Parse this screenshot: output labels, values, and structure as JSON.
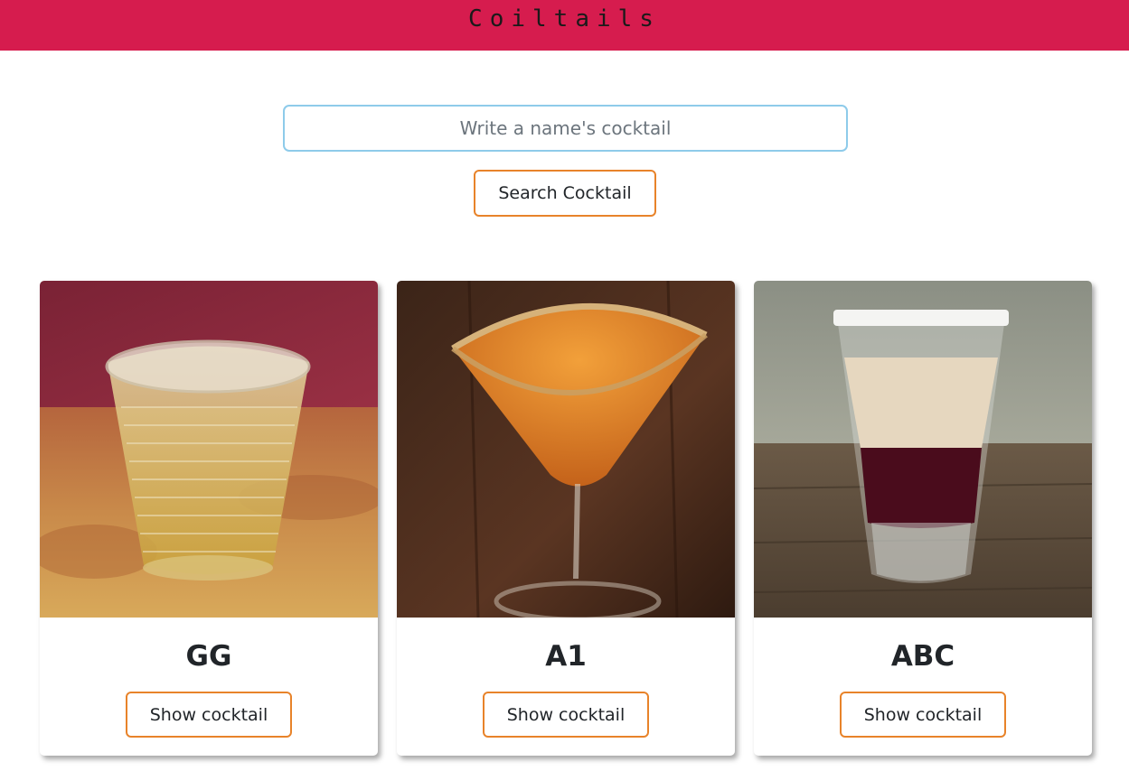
{
  "header": {
    "title": "Coiltails",
    "accent_color": "#d61c4e"
  },
  "search": {
    "placeholder": "Write a name's cocktail",
    "value": "",
    "button_label": "Search Cocktail",
    "input_border_color": "#8ecbea",
    "button_border_color": "#e8832a"
  },
  "cocktails": [
    {
      "name": "GG",
      "button_label": "Show cocktail",
      "image": "tumbler-glass-image"
    },
    {
      "name": "A1",
      "button_label": "Show cocktail",
      "image": "martini-glass-image"
    },
    {
      "name": "ABC",
      "button_label": "Show cocktail",
      "image": "shot-glass-image"
    }
  ]
}
